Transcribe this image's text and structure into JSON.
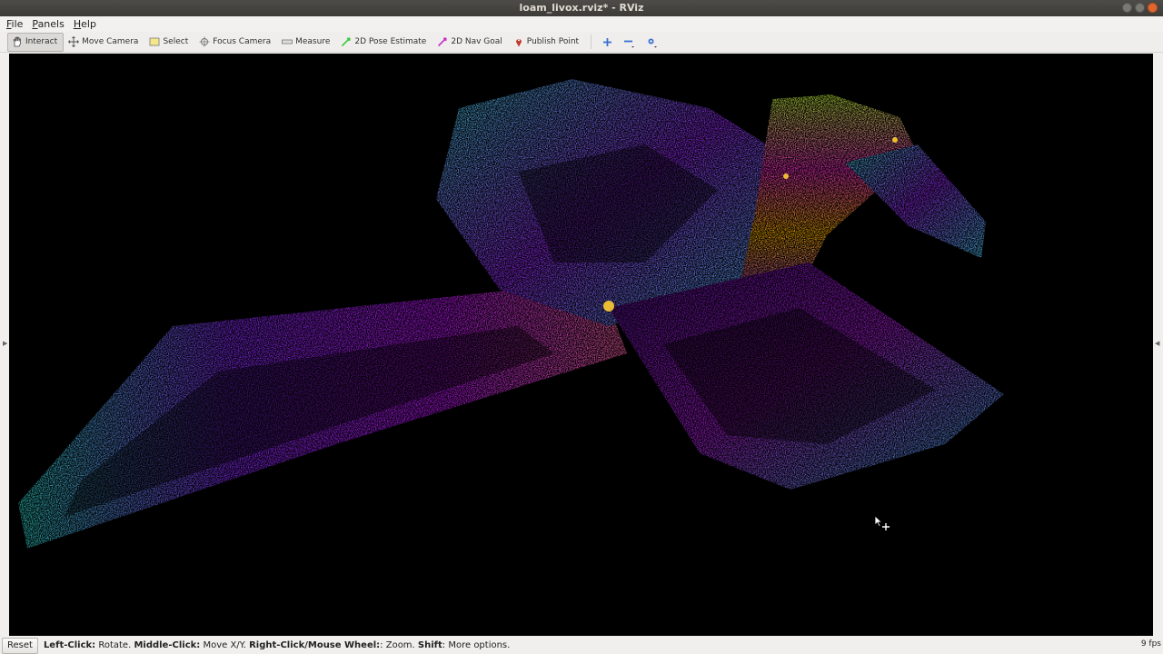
{
  "window": {
    "title": "loam_livox.rviz* - RViz"
  },
  "menu": [
    {
      "prefix": "",
      "underlined": "F",
      "rest": "ile"
    },
    {
      "prefix": "",
      "underlined": "P",
      "rest": "anels"
    },
    {
      "prefix": "",
      "underlined": "H",
      "rest": "elp"
    }
  ],
  "toolbar": {
    "interact": "Interact",
    "move_camera": "Move Camera",
    "select": "Select",
    "focus_camera": "Focus Camera",
    "measure": "Measure",
    "pose_estimate": "2D Pose Estimate",
    "nav_goal": "2D Nav Goal",
    "publish_point": "Publish Point"
  },
  "colors": {
    "pose_estimate": "#3cc83c",
    "nav_goal": "#c832c8",
    "publish_point": "#c0392b",
    "viewport_bg": "#000000"
  },
  "status": {
    "reset": "Reset",
    "parts": [
      {
        "bold": "Left-Click:",
        "text": " Rotate. "
      },
      {
        "bold": "Middle-Click:",
        "text": " Move X/Y. "
      },
      {
        "bold": "Right-Click/Mouse Wheel:",
        "text": ": Zoom. "
      },
      {
        "bold": "Shift",
        "text": ": More options."
      }
    ],
    "fps": "9 fps"
  }
}
